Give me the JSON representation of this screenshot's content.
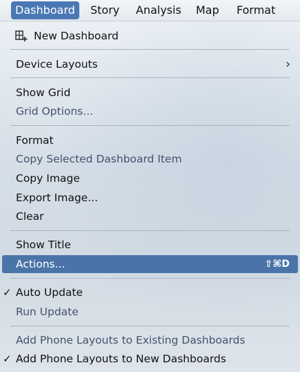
{
  "menubar": {
    "items": [
      {
        "label": "Dashboard",
        "active": true
      },
      {
        "label": "Story",
        "active": false
      },
      {
        "label": "Analysis",
        "active": false
      },
      {
        "label": "Map",
        "active": false
      },
      {
        "label": "Format",
        "active": false
      }
    ]
  },
  "menu": {
    "new_dashboard": {
      "label": "New Dashboard",
      "icon": "new-dashboard-icon"
    },
    "device_layouts": {
      "label": "Device Layouts",
      "submenu_icon": "chevron-right-icon"
    },
    "show_grid": {
      "label": "Show Grid"
    },
    "grid_options": {
      "label": "Grid Options..."
    },
    "format": {
      "label": "Format"
    },
    "copy_selected_item": {
      "label": "Copy Selected Dashboard Item"
    },
    "copy_image": {
      "label": "Copy Image"
    },
    "export_image": {
      "label": "Export Image..."
    },
    "clear": {
      "label": "Clear"
    },
    "show_title": {
      "label": "Show Title"
    },
    "actions": {
      "label": "Actions...",
      "shortcut": "⇧⌘D"
    },
    "auto_update": {
      "label": "Auto Update",
      "checked": true,
      "check_glyph": "✓"
    },
    "run_update": {
      "label": "Run Update"
    },
    "add_phone_existing": {
      "label": "Add Phone Layouts to Existing Dashboards"
    },
    "add_phone_new": {
      "label": "Add Phone Layouts to New Dashboards",
      "checked": true,
      "check_glyph": "✓"
    }
  },
  "colors": {
    "accent": "#4a78b4",
    "highlight": "#4a74a8",
    "disabled_text": "#44536b"
  }
}
